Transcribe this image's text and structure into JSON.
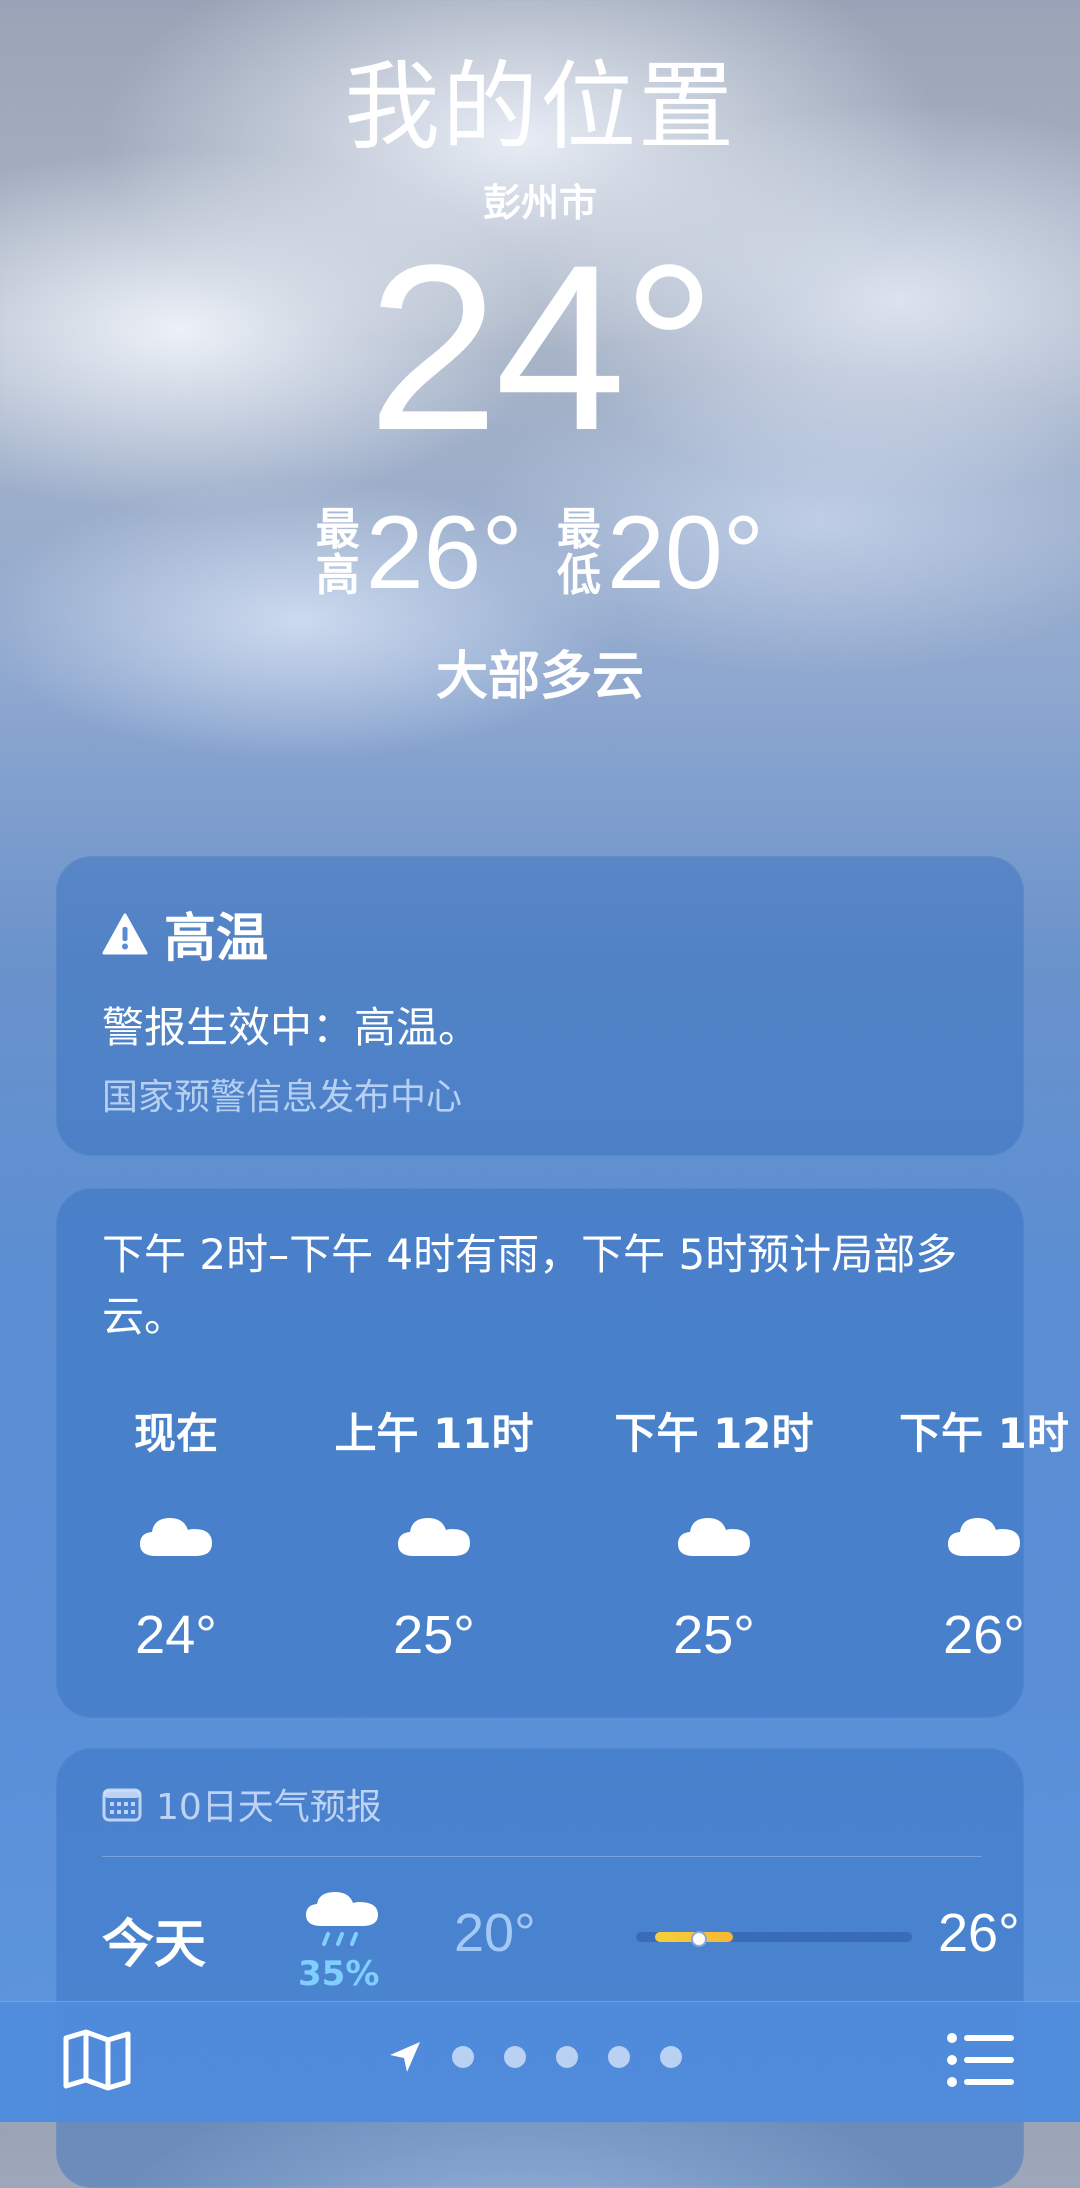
{
  "header": {
    "location": "我的位置",
    "city": "彭州市",
    "temperature": "24°",
    "high_label_1": "最",
    "high_label_2": "高",
    "high": "26°",
    "low_label_1": "最",
    "low_label_2": "低",
    "low": "20°",
    "condition": "大部多云"
  },
  "alert": {
    "icon": "warning-icon",
    "title": "高温",
    "text": "警报生效中：高温。",
    "source": "国家预警信息发布中心"
  },
  "hourly": {
    "summary": "下午 2时–下午 4时有雨，下午 5时预计局部多云。",
    "hours": [
      {
        "label": "现在",
        "icon": "cloud-icon",
        "temp": "24°"
      },
      {
        "label": "上午 11时",
        "icon": "cloud-icon",
        "temp": "25°"
      },
      {
        "label": "下午 12时",
        "icon": "cloud-icon",
        "temp": "25°"
      },
      {
        "label": "下午 1时",
        "icon": "cloud-icon",
        "temp": "26°"
      }
    ]
  },
  "forecast": {
    "icon": "calendar-icon",
    "title": "10日天气预报",
    "days": [
      {
        "name": "今天",
        "icon": "rain-cloud-icon",
        "precip": "35%",
        "low": "20°",
        "high": "26°",
        "bar_fill_start": 0.07,
        "bar_fill_end": 0.35,
        "current_marker": 0.23
      }
    ]
  },
  "bottom_bar": {
    "map_icon": "map-icon",
    "location_icon": "location-arrow-icon",
    "page_count": 5,
    "list_icon": "list-icon"
  },
  "colors": {
    "precip": "#7fd0ff",
    "temp_bar": "#f6cf3b"
  }
}
